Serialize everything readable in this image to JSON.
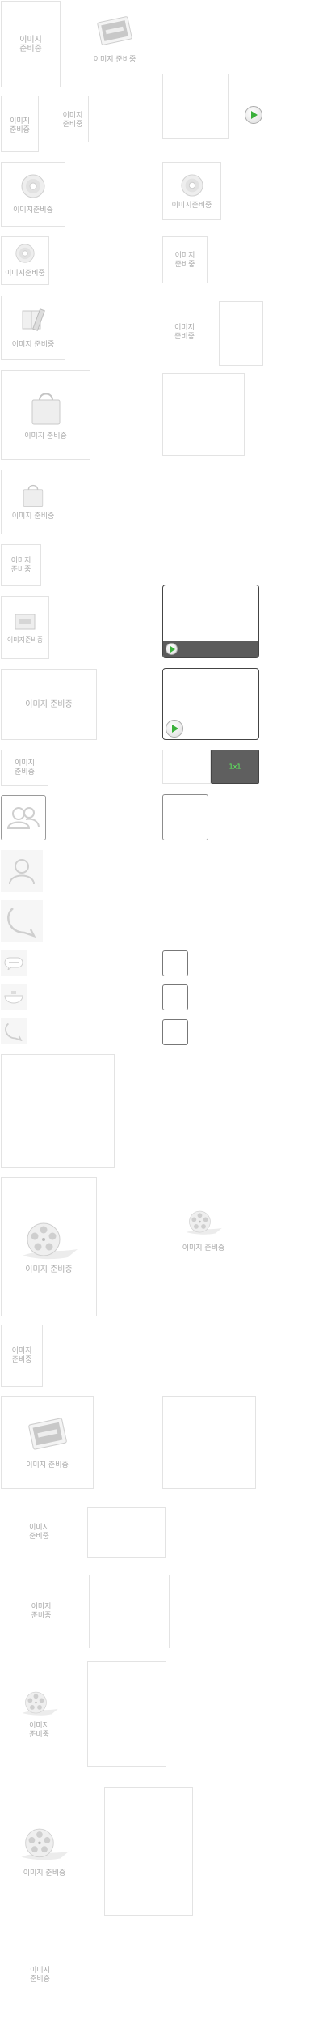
{
  "labels": {
    "preparing": "이미지 준비중",
    "preparing_line1": "이미지",
    "preparing_line2": "준비중",
    "preparing_compact": "이미지준비중",
    "tape_badge": "1x1"
  },
  "icons": {
    "photo": "photo-card-icon",
    "disc": "cd-disc-icon",
    "book": "book-ruler-icon",
    "bag": "shopping-bag-icon",
    "gift": "gift-card-icon",
    "film": "film-reel-icon",
    "play": "play-icon",
    "group": "group-users-icon",
    "user": "user-icon",
    "chat": "chat-bubble-icon",
    "blog": "blog-badge-icon",
    "bowl": "bowl-icon"
  },
  "colors": {
    "placeholder_text": "#aaaaaa",
    "border": "#e3e3e3",
    "player_bar": "#5b5b5b",
    "play_green": "#3bb03b",
    "badge_green": "#5cff5c"
  }
}
